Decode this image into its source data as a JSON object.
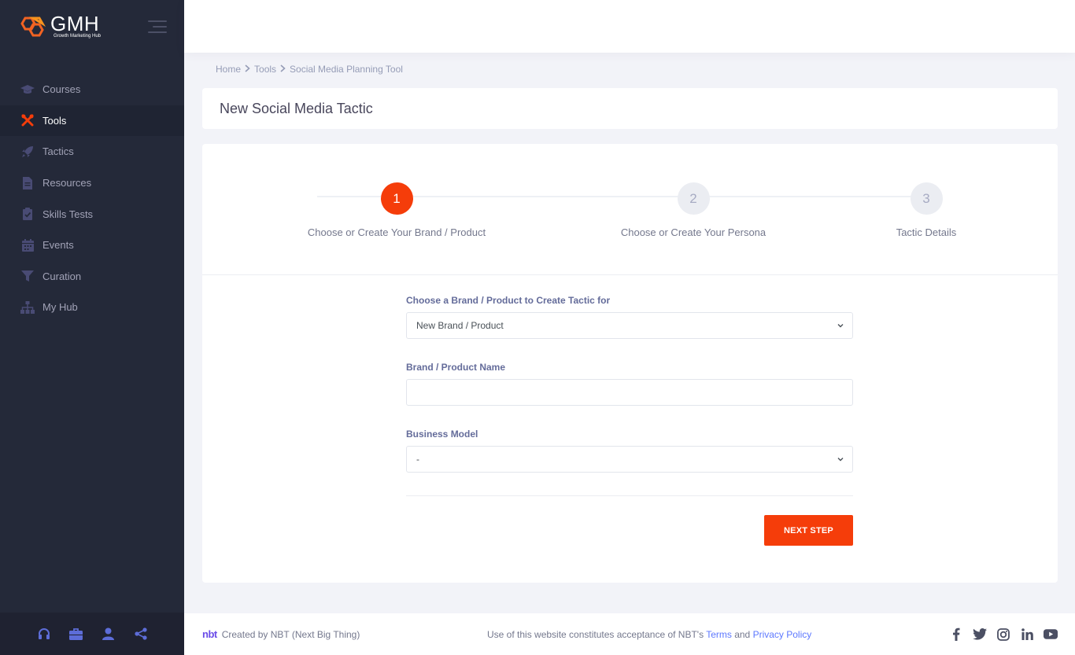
{
  "brand": {
    "title": "GMH",
    "subtitle": "Growth Marketing Hub"
  },
  "sidebar": {
    "items": [
      {
        "label": "Courses",
        "icon": "graduation-cap-icon"
      },
      {
        "label": "Tools",
        "icon": "tools-icon",
        "active": true
      },
      {
        "label": "Tactics",
        "icon": "rocket-icon"
      },
      {
        "label": "Resources",
        "icon": "file-icon"
      },
      {
        "label": "Skills Tests",
        "icon": "clipboard-check-icon"
      },
      {
        "label": "Events",
        "icon": "calendar-icon"
      },
      {
        "label": "Curation",
        "icon": "filter-icon"
      },
      {
        "label": "My Hub",
        "icon": "sitemap-icon"
      }
    ],
    "footer_icons": [
      "headset-icon",
      "briefcase-icon",
      "user-icon",
      "share-icon"
    ]
  },
  "breadcrumb": {
    "items": [
      "Home",
      "Tools",
      "Social Media Planning Tool"
    ]
  },
  "page_title": "New Social Media Tactic",
  "wizard": {
    "steps": [
      {
        "number": "1",
        "label": "Choose or Create Your Brand / Product",
        "active": true
      },
      {
        "number": "2",
        "label": "Choose or Create Your Persona"
      },
      {
        "number": "3",
        "label": "Tactic Details"
      }
    ]
  },
  "form": {
    "brand_select": {
      "label": "Choose a Brand / Product to Create Tactic for",
      "value": "New Brand / Product"
    },
    "brand_name": {
      "label": "Brand / Product Name",
      "value": ""
    },
    "business_model": {
      "label": "Business Model",
      "value": "-"
    },
    "next_button": "NEXT STEP"
  },
  "footer": {
    "logo": "nbt",
    "created_by": "Created by  NBT (Next Big Thing)",
    "notice_prefix": "Use of this website constitutes acceptance of NBT's ",
    "terms": "Terms",
    "and": " and ",
    "privacy": "Privacy Policy",
    "social": [
      "facebook-icon",
      "twitter-icon",
      "instagram-icon",
      "linkedin-icon",
      "youtube-icon"
    ]
  },
  "colors": {
    "accent": "#f53d0a",
    "sidebar_bg": "#242939",
    "link": "#5d78ff"
  }
}
